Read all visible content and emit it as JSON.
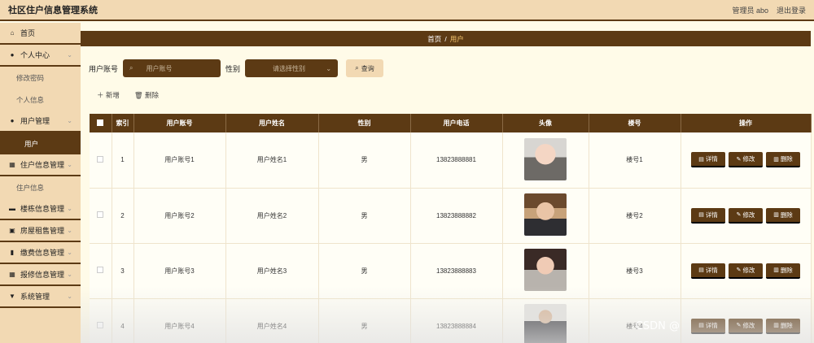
{
  "header": {
    "app_title": "社区住户信息管理系统",
    "admin": "管理员 abo",
    "logout": "退出登录"
  },
  "sidebar": {
    "home": "首页",
    "personal_center": "个人中心",
    "change_password": "修改密码",
    "personal_info": "个人信息",
    "user_management": "用户管理",
    "user": "用户",
    "resident_management": "住户信息管理",
    "resident_info": "住户信息",
    "building_management": "楼栋信息管理",
    "rental_management": "房屋租售管理",
    "fee_management": "缴费信息管理",
    "repair_management": "报修信息管理",
    "system_management": "系统管理"
  },
  "breadcrumb": {
    "home": "首页",
    "sep": "/",
    "current": "用户"
  },
  "search": {
    "account_label": "用户账号",
    "account_placeholder": "用户账号",
    "gender_label": "性别",
    "gender_placeholder": "请选择性别",
    "search_button": "查询"
  },
  "actions": {
    "add": "新增",
    "delete": "删除"
  },
  "table": {
    "headers": [
      "索引",
      "用户账号",
      "用户姓名",
      "性别",
      "用户电话",
      "头像",
      "楼号",
      "操作"
    ],
    "op_labels": {
      "detail": "详情",
      "edit": "修改",
      "delete": "删除"
    },
    "rows": [
      {
        "index": "1",
        "account": "用户账号1",
        "name": "用户姓名1",
        "gender": "男",
        "phone": "13823888881",
        "building": "楼号1"
      },
      {
        "index": "2",
        "account": "用户账号2",
        "name": "用户姓名2",
        "gender": "男",
        "phone": "13823888882",
        "building": "楼号2"
      },
      {
        "index": "3",
        "account": "用户账号3",
        "name": "用户姓名3",
        "gender": "男",
        "phone": "13823888883",
        "building": "楼号3"
      },
      {
        "index": "4",
        "account": "用户账号4",
        "name": "用户姓名4",
        "gender": "男",
        "phone": "13823888884",
        "building": "楼号4"
      }
    ]
  },
  "watermark": "CSDN @",
  "colors": {
    "primary": "#5c3a14",
    "light": "#f2d9b3",
    "background": "#fffbe8"
  }
}
